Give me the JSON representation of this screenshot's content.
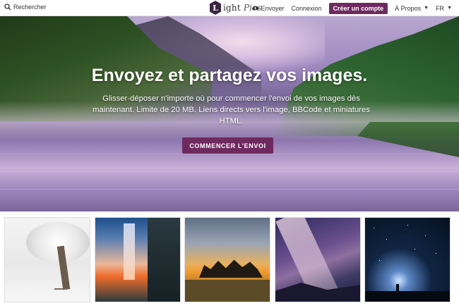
{
  "header": {
    "search_label": "Rechercher",
    "logo_letter": "L",
    "logo_text_main": "ight",
    "logo_text_sub": "Pics",
    "upload_label": "Envoyer",
    "login_label": "Connexion",
    "signup_label": "Créer un compte",
    "about_label": "À Propos",
    "language_label": "FR"
  },
  "hero": {
    "title": "Envoyez et partagez vos images.",
    "description": "Glisser-déposer n'importe où pour commencer l'envoi de vos images dès maintenant. Limite de 20 MB. Liens directs vers l'image, BBCode et miniatures HTML.",
    "cta_label": "COMMENCER L'ENVOI"
  },
  "gallery": {
    "items": [
      {
        "subject": "snowy tree"
      },
      {
        "subject": "waterfall at sunset"
      },
      {
        "subject": "trees at sunset"
      },
      {
        "subject": "milky way"
      },
      {
        "subject": "starry night"
      }
    ]
  },
  "colors": {
    "accent": "#6e2a5f",
    "logo": "#3b2541"
  },
  "icons": {
    "search": "search-icon",
    "upload": "cloud-upload-icon",
    "dropdown": "caret-down-icon"
  }
}
